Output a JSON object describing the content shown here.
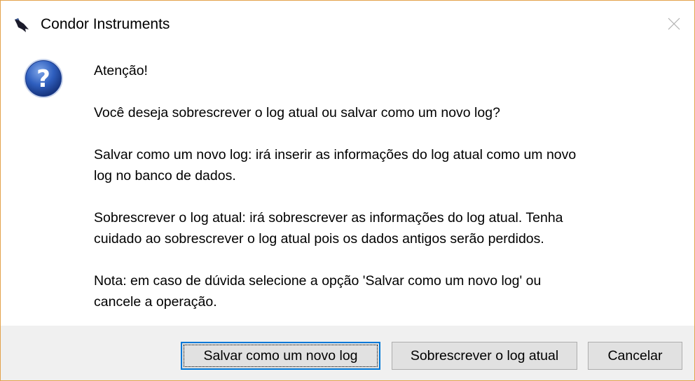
{
  "window": {
    "title": "Condor Instruments",
    "app_icon": "condor-bird-icon",
    "close_icon": "close-icon",
    "border_color": "#e3a24c"
  },
  "message": {
    "icon": "question-icon",
    "heading": "Atenção!",
    "paragraphs": [
      "Você deseja sobrescrever o log atual ou salvar como um novo log?",
      "Salvar como um novo log: irá inserir as informações do log atual como um novo\nlog no banco de dados.",
      "Sobrescrever o log atual: irá sobrescrever as informações do log atual. Tenha\ncuidado ao sobrescrever o log atual pois os dados antigos serão perdidos.",
      "Nota: em caso de dúvida selecione a opção 'Salvar como um novo log' ou\ncancele a operação."
    ]
  },
  "buttons": {
    "save_new": "Salvar como um novo log",
    "overwrite": "Sobrescrever o log atual",
    "cancel": "Cancelar"
  }
}
